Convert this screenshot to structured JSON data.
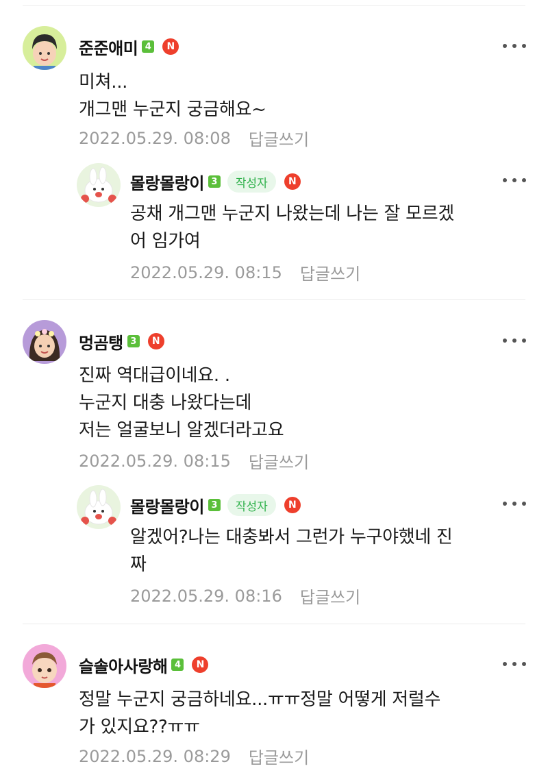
{
  "comments": [
    {
      "nickname": "준준애미",
      "level": "4",
      "new_badge": "N",
      "lines": "미쳐...\n개그맨 누군지 궁금해요~",
      "date": "2022.05.29. 08:08",
      "reply_label": "답글쓰기"
    },
    {
      "nickname": "몰랑몰랑이",
      "level": "3",
      "writer_badge": "작성자",
      "new_badge": "N",
      "lines": "공채 개그맨 누군지 나왔는데 나는 잘 모르겠\n어 임가여",
      "date": "2022.05.29. 08:15",
      "reply_label": "답글쓰기"
    },
    {
      "nickname": "멍곰탱",
      "level": "3",
      "new_badge": "N",
      "lines": "진짜 역대급이네요. .\n누군지 대충 나왔다는데\n저는 얼굴보니 알겠더라고요",
      "date": "2022.05.29. 08:15",
      "reply_label": "답글쓰기"
    },
    {
      "nickname": "몰랑몰랑이",
      "level": "3",
      "writer_badge": "작성자",
      "new_badge": "N",
      "lines": "알겠어?나는 대충봐서 그런가 누구야했네 진\n짜",
      "date": "2022.05.29. 08:16",
      "reply_label": "답글쓰기"
    },
    {
      "nickname": "슬솔아사랑해",
      "level": "4",
      "new_badge": "N",
      "lines": "정말 누군지 궁금하네요...ㅠㅠ정말 어떻게 저럴수\n가 있지요??ㅠㅠ",
      "date": "2022.05.29. 08:29",
      "reply_label": "답글쓰기"
    }
  ],
  "colors": {
    "level_badge": "#5bbf3a",
    "new_badge": "#ee3f2c",
    "writer_badge_bg": "#e8f7ea",
    "writer_badge_text": "#2fb14b",
    "meta_text": "#9a9a9a"
  },
  "icons": {
    "more": "more-horizontal-icon",
    "avatar_1": "boy-cartoon-avatar",
    "avatar_2": "white-bunny-avatar",
    "avatar_3": "girl-flower-crown-avatar",
    "avatar_5": "baby-cartoon-avatar"
  }
}
